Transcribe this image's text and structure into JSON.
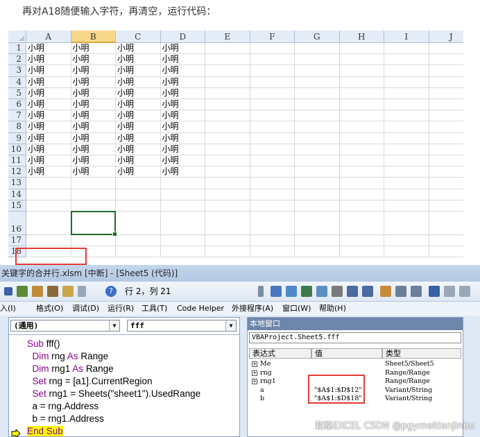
{
  "caption": "再对A18随便输入字符，再清空，运行代码：",
  "spreadsheet": {
    "columns": [
      "A",
      "B",
      "C",
      "D",
      "E",
      "F",
      "G",
      "H",
      "I",
      "J"
    ],
    "selected_column": "B",
    "rows": [
      "1",
      "2",
      "3",
      "4",
      "5",
      "6",
      "7",
      "8",
      "9",
      "10",
      "11",
      "12",
      "13",
      "14",
      "15",
      "16",
      "17",
      "18"
    ],
    "cell_text": "小明",
    "filled_rows": 12,
    "filled_cols": 4,
    "active_cell": "B16"
  },
  "vbe": {
    "title": "关键字的合并行.xlsm [中断] - [Sheet5 (代码)]",
    "position": "行 2，列 21",
    "menu": [
      "入(I)",
      "格式(O)",
      "调试(D)",
      "运行(R)",
      "工具(T)",
      "Code Helper",
      "外接程序(A)",
      "窗口(W)",
      "帮助(H)"
    ],
    "object_combo": "(通用)",
    "proc_combo": "fff",
    "code_lines": [
      {
        "text": "Sub fff()",
        "indent": 0
      },
      {
        "text": "Dim rng As Range",
        "indent": 1
      },
      {
        "text": "Dim rng1 As Range",
        "indent": 1
      },
      {
        "text": "Set rng = [a1].CurrentRegion",
        "indent": 1
      },
      {
        "text": "Set rng1 = Sheets(\"sheet1\").UsedRange",
        "indent": 1
      },
      {
        "text": "a = rng.Address",
        "indent": 1
      },
      {
        "text": "b = rng1.Address",
        "indent": 1
      },
      {
        "text": "End Sub",
        "indent": 0
      }
    ],
    "locals": {
      "title": "本地窗口",
      "context": "VBAProject.Sheet5.fff",
      "headers": [
        "表达式",
        "值",
        "类型"
      ],
      "rows": [
        {
          "expr": "Me",
          "value": "",
          "type": "Sheet5/Sheet5",
          "expand": true
        },
        {
          "expr": "rng",
          "value": "",
          "type": "Range/Range",
          "expand": true
        },
        {
          "expr": "rng1",
          "value": "",
          "type": "Range/Range",
          "expand": true
        },
        {
          "expr": "a",
          "value": "\"$A$1:$D$12\"",
          "type": "Variant/String",
          "expand": false
        },
        {
          "expr": "b",
          "value": "\"$A$1:$D$18\"",
          "type": "Variant/String",
          "expand": false
        }
      ]
    }
  },
  "watermark": "CSDN @pgymeitianjinbu",
  "watermark2": "套路EXCEL"
}
